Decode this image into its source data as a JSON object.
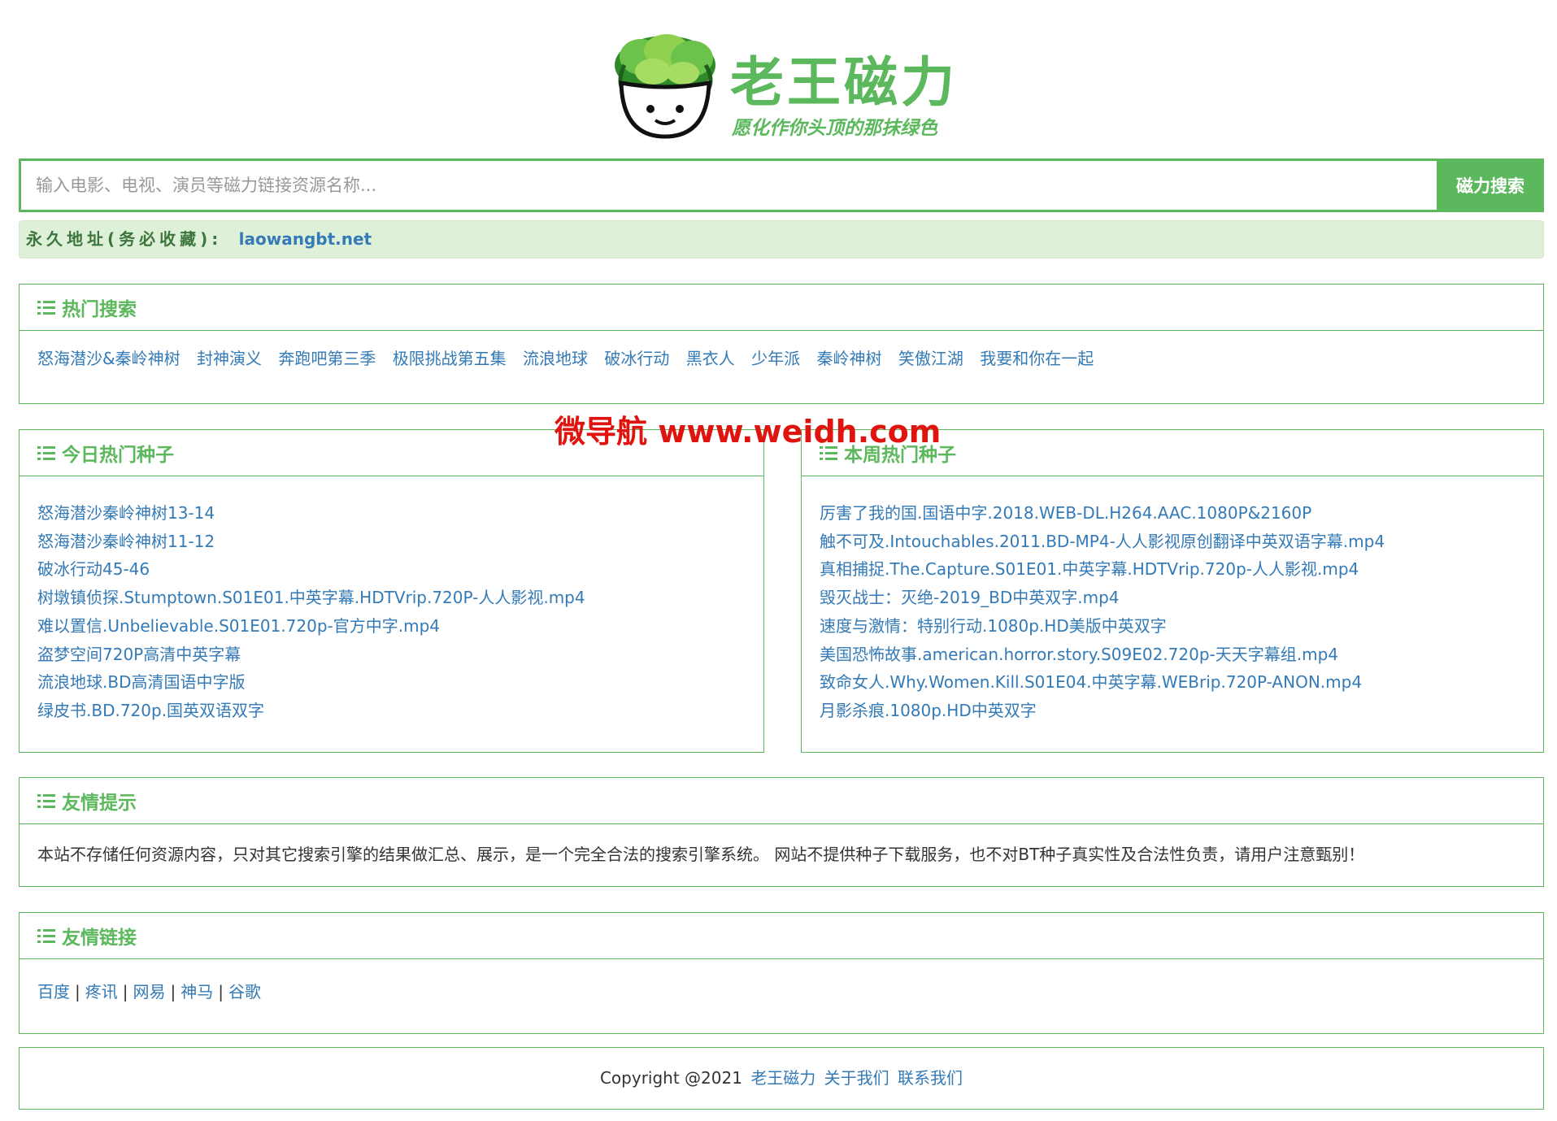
{
  "logo": {
    "title": "老王磁力",
    "slogan": "愿化作你头顶的那抹绿色"
  },
  "search": {
    "placeholder": "输入电影、电视、演员等磁力链接资源名称...",
    "button_label": "磁力搜索"
  },
  "permanent_address": {
    "label": "永久地址(务必收藏):",
    "url": "laowangbt.net"
  },
  "hot_search": {
    "title": "热门搜索",
    "items": [
      "怒海潜沙&秦岭神树",
      "封神演义",
      "奔跑吧第三季",
      "极限挑战第五集",
      "流浪地球",
      "破冰行动",
      "黑衣人",
      "少年派",
      "秦岭神树",
      "笑傲江湖",
      "我要和你在一起"
    ]
  },
  "today_hot": {
    "title": "今日热门种子",
    "items": [
      "怒海潜沙秦岭神树13-14",
      "怒海潜沙秦岭神树11-12",
      "破冰行动45-46",
      "树墩镇侦探.Stumptown.S01E01.中英字幕.HDTVrip.720P-人人影视.mp4",
      "难以置信.Unbelievable.S01E01.720p-官方中字.mp4",
      "盗梦空间720P高清中英字幕",
      "流浪地球.BD高清国语中字版",
      "绿皮书.BD.720p.国英双语双字"
    ]
  },
  "week_hot": {
    "title": "本周热门种子",
    "items": [
      "厉害了我的国.国语中字.2018.WEB-DL.H264.AAC.1080P&2160P",
      "触不可及.Intouchables.2011.BD-MP4-人人影视原创翻译中英双语字幕.mp4",
      "真相捕捉.The.Capture.S01E01.中英字幕.HDTVrip.720p-人人影视.mp4",
      "毁灭战士：灭绝-2019_BD中英双字.mp4",
      "速度与激情：特别行动.1080p.HD美版中英双字",
      "美国恐怖故事.american.horror.story.S09E02.720p-天天字幕组.mp4",
      "致命女人.Why.Women.Kill.S01E04.中英字幕.WEBrip.720P-ANON.mp4",
      "月影杀痕.1080p.HD中英双字"
    ]
  },
  "notice": {
    "title": "友情提示",
    "text": "本站不存储任何资源内容，只对其它搜索引擎的结果做汇总、展示，是一个完全合法的搜索引擎系统。 网站不提供种子下载服务，也不对BT种子真实性及合法性负责，请用户注意甄别！"
  },
  "friend_links": {
    "title": "友情链接",
    "items": [
      "百度",
      "疼讯",
      "网易",
      "神马",
      "谷歌"
    ]
  },
  "footer": {
    "copyright": "Copyright @2021",
    "site_link": "老王磁力",
    "about_link": "关于我们",
    "contact_link": "联系我们"
  },
  "watermark": {
    "text": "微导航 www.weidh.com"
  },
  "colors": {
    "brand_green": "#5cb85c",
    "link_blue": "#337ab7",
    "alert_bg": "#dff0d8",
    "watermark_red": "#e0140f"
  }
}
